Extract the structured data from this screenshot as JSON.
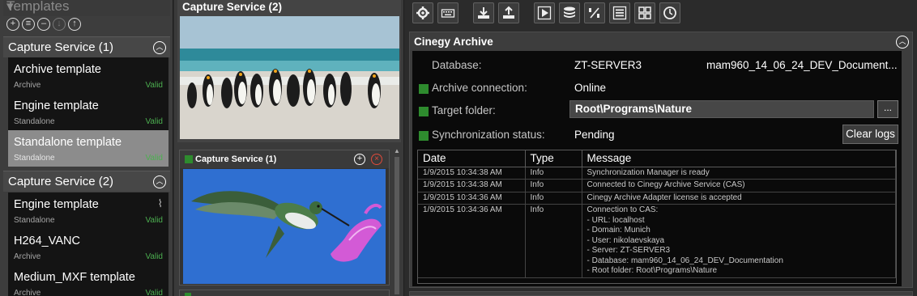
{
  "templates_panel": {
    "title": "Templates",
    "pin_glyph": "▾",
    "tool_icons": [
      "add-icon",
      "list-icon",
      "minus-icon",
      "download-icon",
      "upload-icon"
    ],
    "groups": [
      {
        "title": "Capture Service (1)",
        "items": [
          {
            "name": "Archive template",
            "kind": "Archive",
            "status": "Valid"
          },
          {
            "name": "Engine template",
            "kind": "Standalone",
            "status": "Valid"
          },
          {
            "name": "Standalone template",
            "kind": "Standalone",
            "status": "Valid",
            "selected": true
          }
        ]
      },
      {
        "title": "Capture Service (2)",
        "items": [
          {
            "name": "Engine template",
            "kind": "Standalone",
            "status": "Valid",
            "attachment": true
          },
          {
            "name": "H264_VANC",
            "kind": "Archive",
            "status": "Valid"
          },
          {
            "name": "Medium_MXF template",
            "kind": "Archive",
            "status": "Valid"
          }
        ]
      }
    ]
  },
  "capture_panel": {
    "service_2_title": "Capture Service (2)",
    "service_1_title": "Capture Service (1)",
    "service_1_status_color": "#2e8b2e"
  },
  "toolbar": {
    "icons": [
      "settings-icon",
      "keyboard-icon",
      "import-icon",
      "export-icon",
      "play-icon",
      "database-icon",
      "percent-icon",
      "list-icon",
      "grid-icon",
      "clock-icon"
    ]
  },
  "archive": {
    "title": "Cinegy Archive",
    "database_label": "Database:",
    "database_server": "ZT-SERVER3",
    "database_name": "mam960_14_06_24_DEV_Document...",
    "connection_label": "Archive connection:",
    "connection_value": "Online",
    "folder_label": "Target folder:",
    "folder_value": "Root\\Programs\\Nature",
    "browse_label": "...",
    "sync_label": "Synchronization status:",
    "sync_value": "Pending",
    "clear_logs_label": "Clear logs",
    "status_color": "#2e8b2e",
    "log": {
      "columns": [
        "Date",
        "Type",
        "Message"
      ],
      "rows": [
        {
          "date": "1/9/2015 10:34:38 AM",
          "type": "Info",
          "message": [
            "Synchronization Manager is ready"
          ]
        },
        {
          "date": "1/9/2015 10:34:38 AM",
          "type": "Info",
          "message": [
            "Connected to Cinegy Archive Service (CAS)"
          ]
        },
        {
          "date": "1/9/2015 10:34:36 AM",
          "type": "Info",
          "message": [
            "Cinegy Archive Adapter license is accepted"
          ]
        },
        {
          "date": "1/9/2015 10:34:36 AM",
          "type": "Info",
          "message": [
            "Connection to CAS:",
            "- URL: localhost",
            "- Domain: Munich",
            "- User: nikolaevskaya",
            "- Server: ZT-SERVER3",
            "- Database: mam960_14_06_24_DEV_Documentation",
            "- Root folder: Root\\Programs\\Nature"
          ]
        }
      ]
    }
  }
}
